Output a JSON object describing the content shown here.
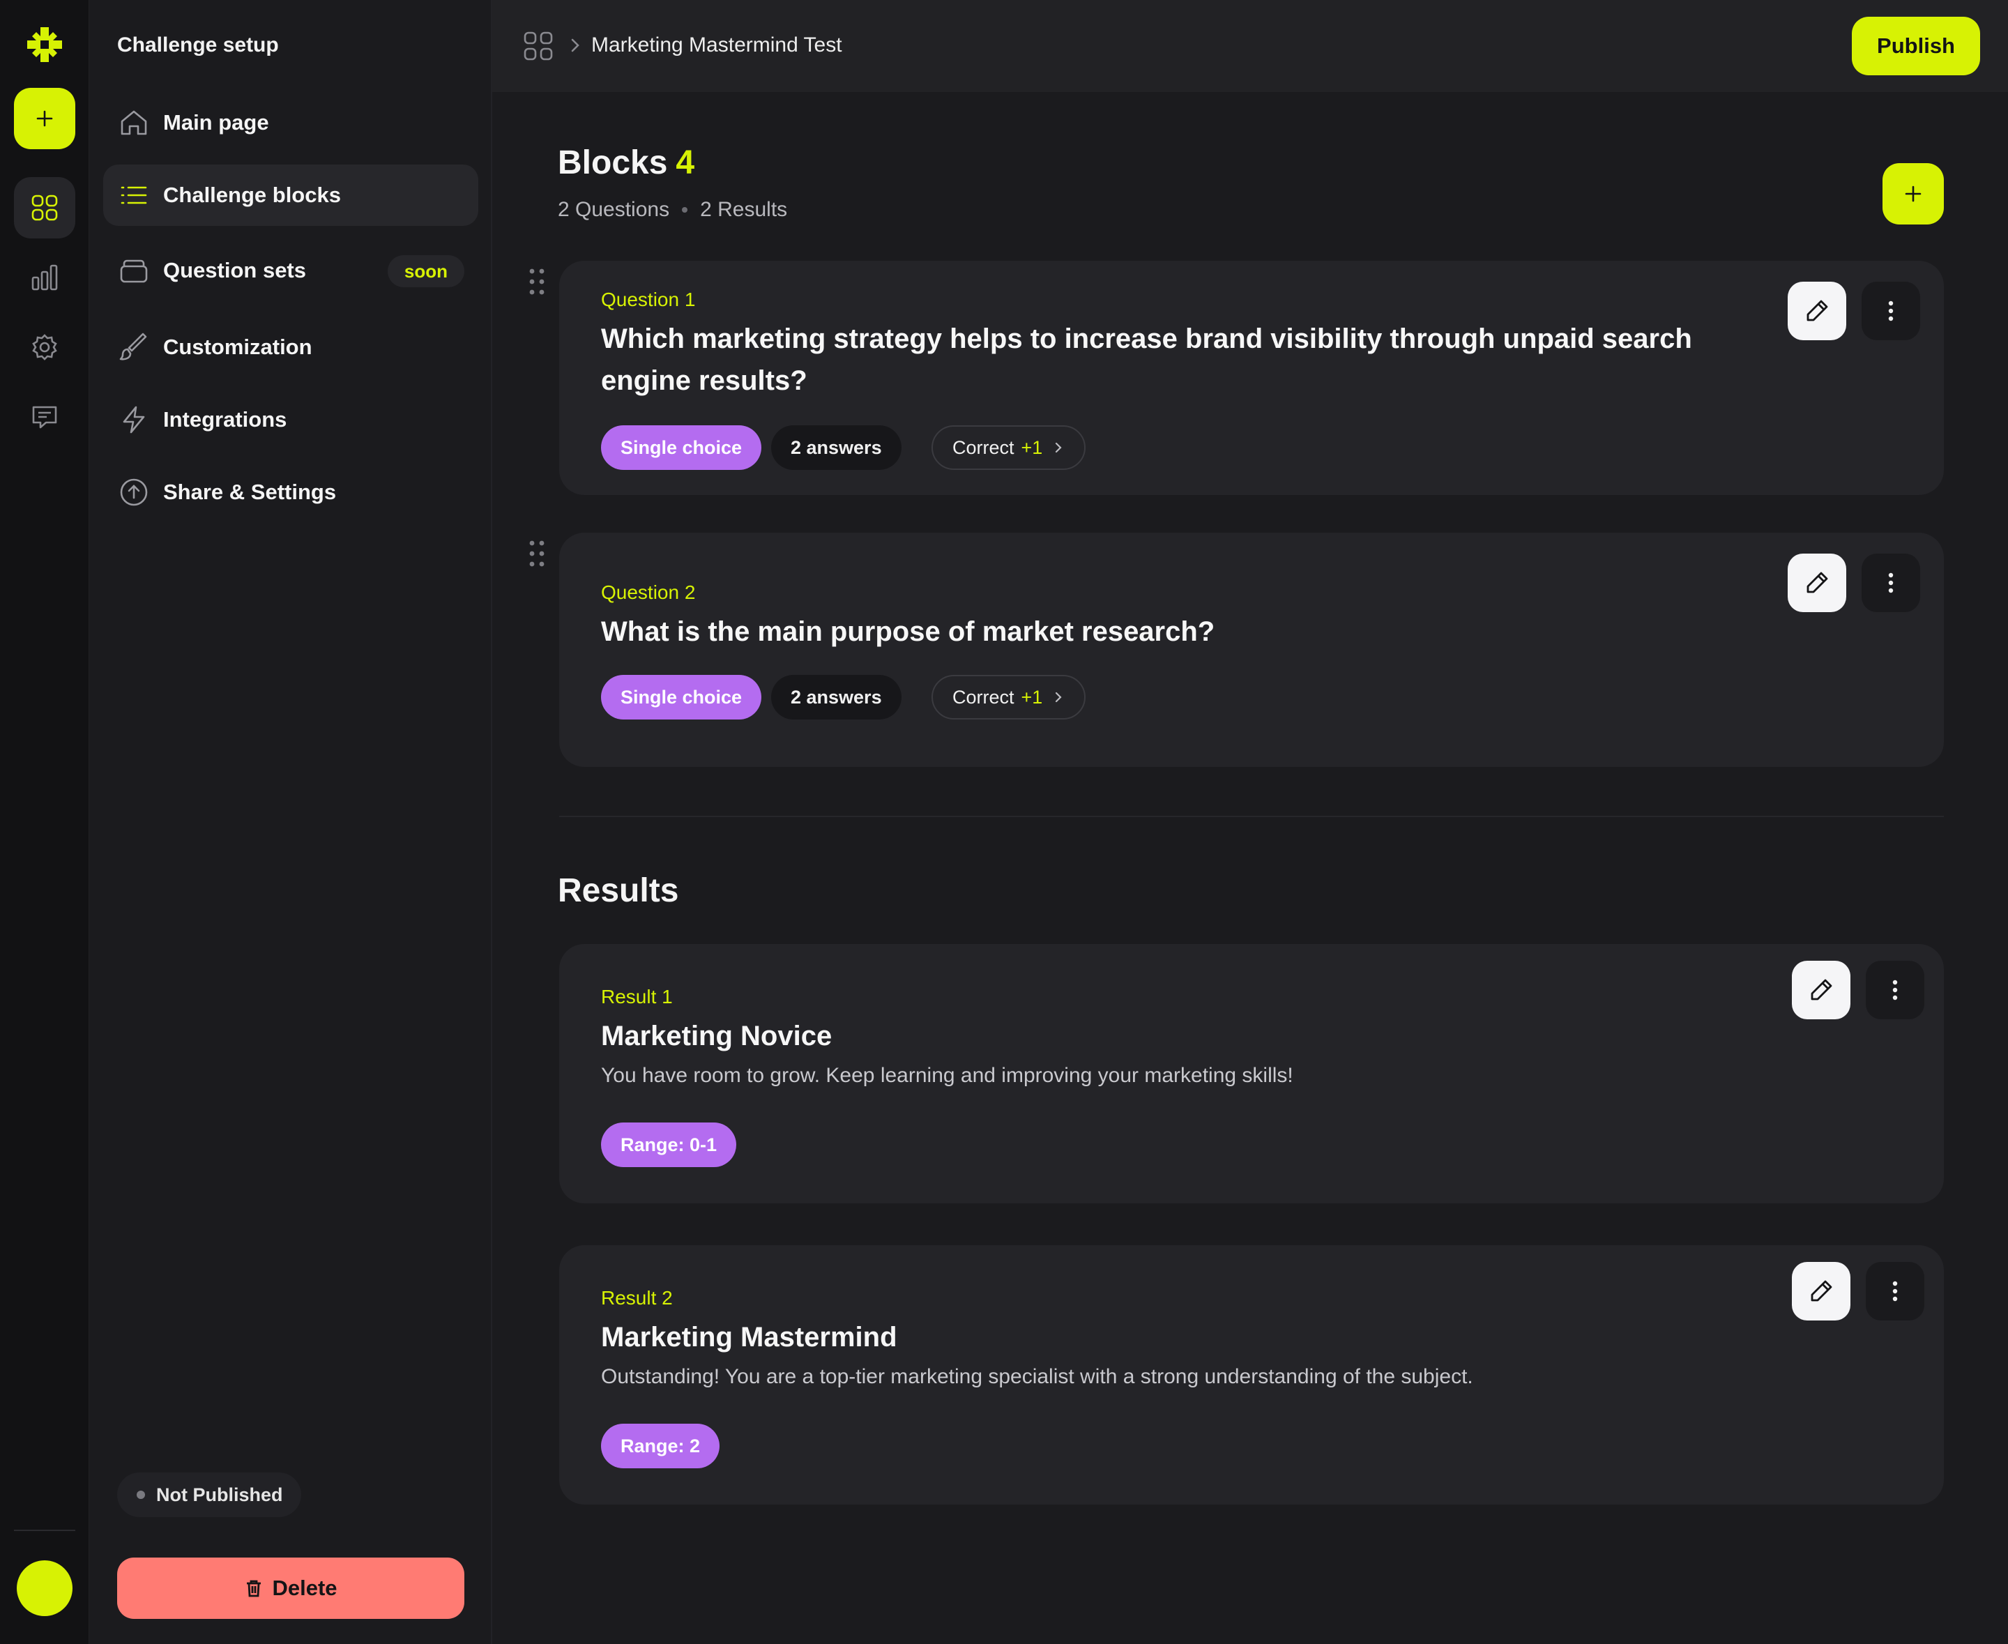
{
  "rail": {
    "items": [
      {
        "name": "grid-icon",
        "active": true
      },
      {
        "name": "chart-icon",
        "active": false
      },
      {
        "name": "gear-icon",
        "active": false
      },
      {
        "name": "chat-icon",
        "active": false
      }
    ]
  },
  "sidebar": {
    "title": "Challenge setup",
    "items": [
      {
        "label": "Main page",
        "icon": "home-icon"
      },
      {
        "label": "Challenge blocks",
        "icon": "list-icon",
        "active": true
      },
      {
        "label": "Question sets",
        "icon": "stack-icon",
        "badge": "soon"
      },
      {
        "label": "Customization",
        "icon": "brush-icon"
      },
      {
        "label": "Integrations",
        "icon": "bolt-icon"
      },
      {
        "label": "Share & Settings",
        "icon": "upload-circle-icon"
      }
    ],
    "status": "Not Published",
    "delete_label": "Delete"
  },
  "topbar": {
    "breadcrumb": "Marketing Mastermind Test",
    "publish_label": "Publish"
  },
  "blocks": {
    "heading": "Blocks",
    "count": "4",
    "questions_count": "2 Questions",
    "results_count": "2 Results",
    "questions": [
      {
        "kicker": "Question 1",
        "text": "Which marketing strategy helps to increase brand visibility through unpaid search engine results?",
        "type": "Single choice",
        "answers": "2 answers",
        "correct_label": "Correct",
        "correct_value": "+1"
      },
      {
        "kicker": "Question 2",
        "text": "What is the main purpose of market research?",
        "type": "Single choice",
        "answers": "2 answers",
        "correct_label": "Correct",
        "correct_value": "+1"
      }
    ]
  },
  "results": {
    "heading": "Results",
    "items": [
      {
        "kicker": "Result 1",
        "title": "Marketing Novice",
        "description": "You have room to grow. Keep learning and improving your marketing skills!",
        "range": "Range: 0-1"
      },
      {
        "kicker": "Result 2",
        "title": "Marketing Mastermind",
        "description": "Outstanding! You are a top-tier marketing specialist with a strong understanding of the subject.",
        "range": "Range: 2"
      }
    ]
  },
  "colors": {
    "accent": "#d7f204",
    "purple": "#b46cf0",
    "danger": "#ff7b73",
    "background": "#1b1b1e",
    "card": "#242428"
  }
}
